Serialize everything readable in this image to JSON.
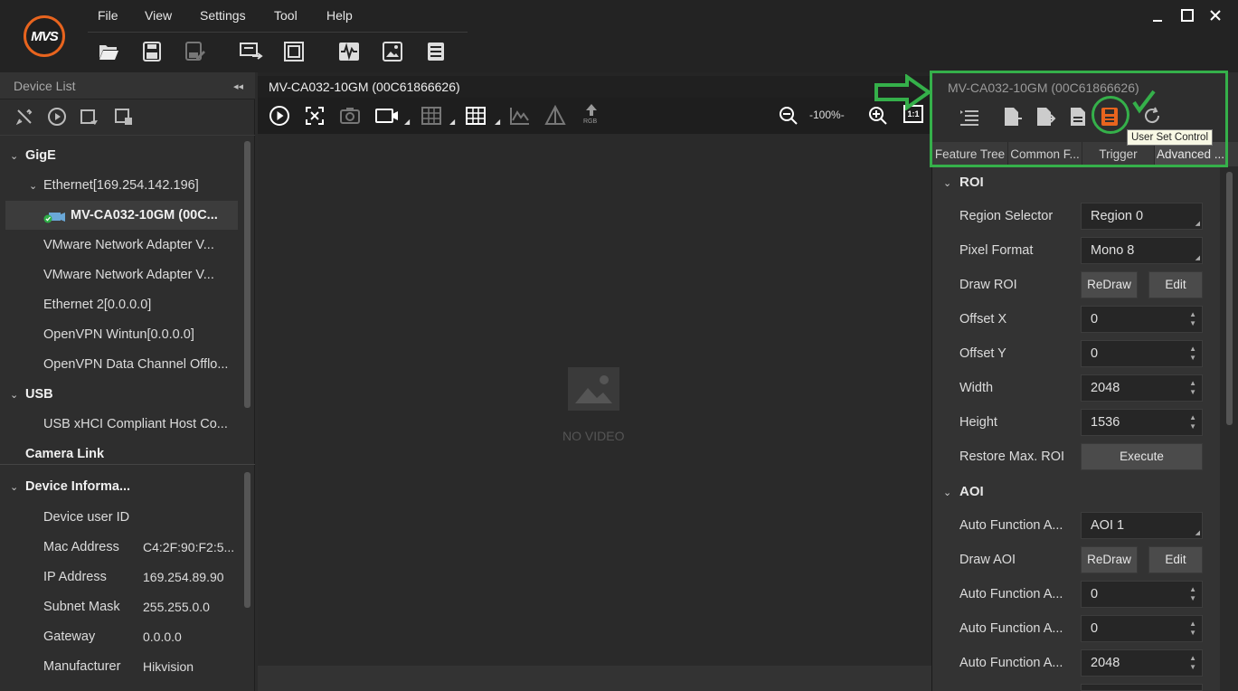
{
  "app": {
    "logo_text": "MVS"
  },
  "menu": {
    "file": "File",
    "view": "View",
    "settings": "Settings",
    "tool": "Tool",
    "help": "Help"
  },
  "device_list": {
    "title": "Device List",
    "tree": [
      {
        "label": "GigE"
      },
      {
        "label": "Ethernet[169.254.142.196]"
      },
      {
        "label": "MV-CA032-10GM (00C..."
      },
      {
        "label": "VMware Network Adapter V..."
      },
      {
        "label": "VMware Network Adapter V..."
      },
      {
        "label": "Ethernet 2[0.0.0.0]"
      },
      {
        "label": "OpenVPN Wintun[0.0.0.0]"
      },
      {
        "label": "OpenVPN Data Channel Offlo..."
      },
      {
        "label": "USB"
      },
      {
        "label": "USB xHCI Compliant Host Co..."
      },
      {
        "label": "Camera Link"
      }
    ]
  },
  "device_info": {
    "title": "Device Informa...",
    "rows": [
      {
        "key": "Device user ID",
        "value": ""
      },
      {
        "key": "Mac Address",
        "value": "C4:2F:90:F2:5..."
      },
      {
        "key": "IP Address",
        "value": "169.254.89.90"
      },
      {
        "key": "Subnet Mask",
        "value": "255.255.0.0"
      },
      {
        "key": "Gateway",
        "value": "0.0.0.0"
      },
      {
        "key": "Manufacturer",
        "value": "Hikvision"
      }
    ]
  },
  "center": {
    "tab_title": "MV-CA032-10GM (00C61866626)",
    "zoom": "-100%-",
    "zoom_reset": "1:1",
    "rgb": "RGB",
    "no_video": "NO VIDEO"
  },
  "right_panel": {
    "title": "MV-CA032-10GM (00C61866626)",
    "tooltip": "User Set Control",
    "tabs": [
      "Feature Tree",
      "Common F...",
      "Trigger",
      "Advanced ..."
    ],
    "roi": {
      "section": "ROI",
      "region_selector": {
        "label": "Region Selector",
        "value": "Region 0"
      },
      "pixel_format": {
        "label": "Pixel Format",
        "value": "Mono 8"
      },
      "draw_roi": {
        "label": "Draw ROI",
        "redraw": "ReDraw",
        "edit": "Edit"
      },
      "offset_x": {
        "label": "Offset X",
        "value": "0"
      },
      "offset_y": {
        "label": "Offset Y",
        "value": "0"
      },
      "width": {
        "label": "Width",
        "value": "2048"
      },
      "height": {
        "label": "Height",
        "value": "1536"
      },
      "restore": {
        "label": "Restore Max. ROI",
        "button": "Execute"
      }
    },
    "aoi": {
      "section": "AOI",
      "selector": {
        "label": "Auto Function A...",
        "value": "AOI 1"
      },
      "draw_aoi": {
        "label": "Draw AOI",
        "redraw": "ReDraw",
        "edit": "Edit"
      },
      "offset_x": {
        "label": "Auto Function A...",
        "value": "0"
      },
      "offset_y": {
        "label": "Auto Function A...",
        "value": "0"
      },
      "width": {
        "label": "Auto Function A...",
        "value": "2048"
      }
    }
  },
  "colors": {
    "accent": "#e8641e",
    "annotation": "#35b04a"
  }
}
